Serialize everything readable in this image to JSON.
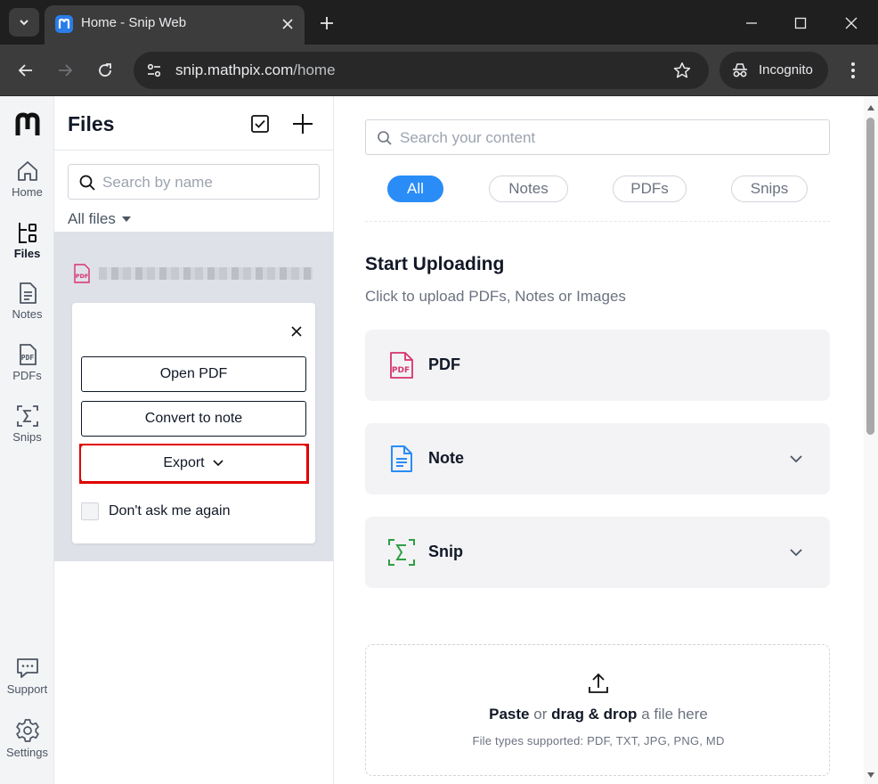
{
  "browser": {
    "tab_title": "Home - Snip Web",
    "url_host": "snip.mathpix.com",
    "url_path": "/home",
    "incognito_label": "Incognito"
  },
  "rail": {
    "items": [
      {
        "label": "Home",
        "icon": "home-icon"
      },
      {
        "label": "Files",
        "icon": "files-icon"
      },
      {
        "label": "Notes",
        "icon": "notes-icon"
      },
      {
        "label": "PDFs",
        "icon": "pdfs-icon"
      },
      {
        "label": "Snips",
        "icon": "snips-icon"
      }
    ],
    "bottom": [
      {
        "label": "Support",
        "icon": "support-icon"
      },
      {
        "label": "Settings",
        "icon": "settings-icon"
      }
    ]
  },
  "files": {
    "title": "Files",
    "search_placeholder": "Search by name",
    "filter_label": "All files",
    "popover": {
      "open_label": "Open PDF",
      "convert_label": "Convert to note",
      "export_label": "Export",
      "checkbox_label": "Don't ask me again"
    }
  },
  "main": {
    "search_placeholder": "Search your content",
    "chips": [
      "All",
      "Notes",
      "PDFs",
      "Snips"
    ],
    "start_title": "Start Uploading",
    "start_subtitle": "Click to upload PDFs, Notes or Images",
    "cards": [
      {
        "label": "PDF",
        "icon": "pdf-icon"
      },
      {
        "label": "Note",
        "icon": "note-icon"
      },
      {
        "label": "Snip",
        "icon": "snip-icon"
      }
    ],
    "dropzone": {
      "paste": "Paste",
      "or": "or",
      "drag": "drag & drop",
      "rest": "a file here",
      "types": "File types supported: PDF, TXT, JPG, PNG, MD"
    }
  },
  "colors": {
    "accent": "#2a8cf7",
    "highlight": "#e00000",
    "pdf": "#d6336c",
    "note": "#2a8cf7",
    "snip": "#2f9e44"
  }
}
